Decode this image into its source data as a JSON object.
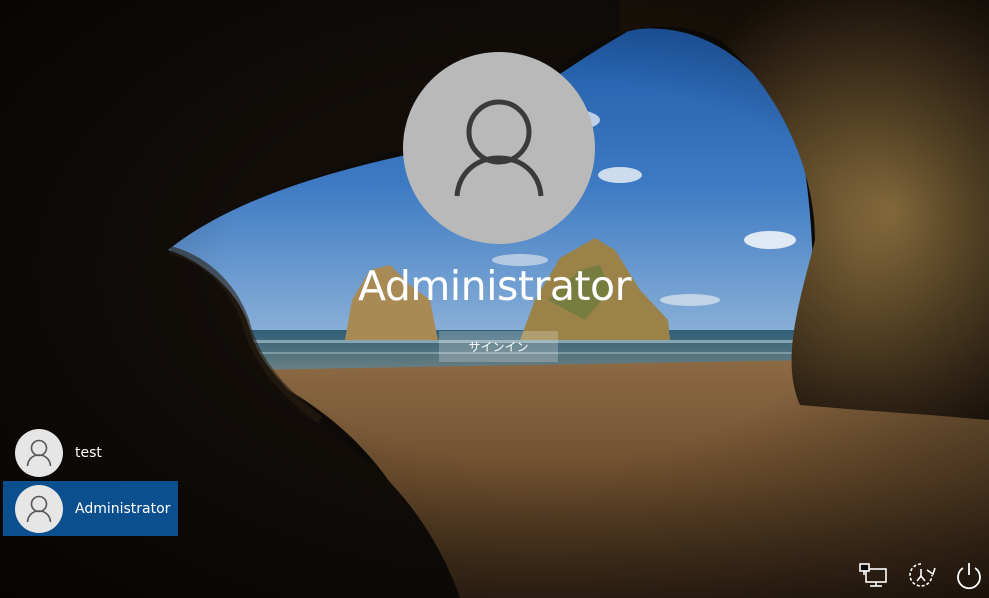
{
  "login": {
    "selected_user": "Administrator",
    "signin_label": "サインイン"
  },
  "users": [
    {
      "name": "test",
      "selected": false
    },
    {
      "name": "Administrator",
      "selected": true
    }
  ],
  "tray": {
    "icons": [
      "network-icon",
      "ease-of-access-icon",
      "power-icon"
    ]
  },
  "colors": {
    "selected_user_bg": "#0b4f8f",
    "avatar_large_bg": "#b9b9b9",
    "avatar_small_bg": "#e6e6e6",
    "signin_button_bg": "rgba(255,255,255,0.22)"
  }
}
